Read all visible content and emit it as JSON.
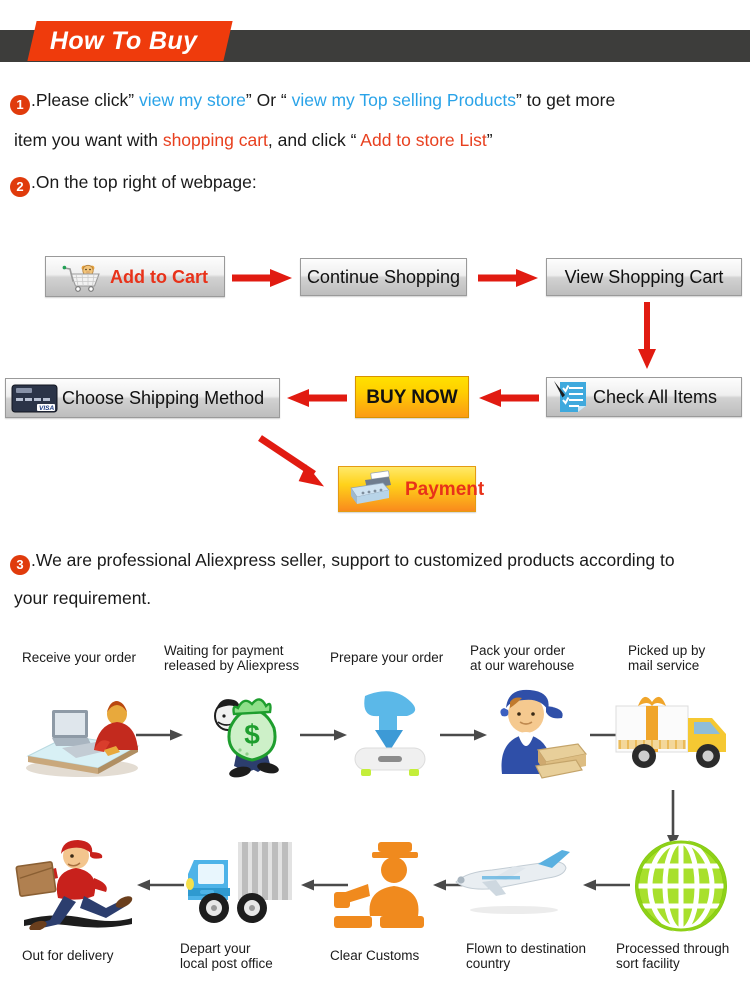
{
  "header": {
    "title": "How To Buy",
    "bar_color": "#3d3d3b",
    "tag_color": "#ef3b0c"
  },
  "steps": [
    {
      "number": "1",
      "lines": [
        [
          {
            "t": ".Please click” ",
            "c": "black"
          },
          {
            "t": "view my store",
            "c": "blue"
          },
          {
            "t": "”  Or  “ ",
            "c": "black"
          },
          {
            "t": "view my Top selling Products",
            "c": "blue"
          },
          {
            "t": "”   to get more",
            "c": "black"
          }
        ],
        [
          {
            "t": "item you want with ",
            "c": "black"
          },
          {
            "t": "shopping cart",
            "c": "red"
          },
          {
            "t": ", and click   “ ",
            "c": "black"
          },
          {
            "t": "Add to store List",
            "c": "red"
          },
          {
            "t": "”",
            "c": "black"
          }
        ]
      ]
    },
    {
      "number": "2",
      "lines": [
        [
          {
            "t": ".On the top right of webpage:",
            "c": "black"
          }
        ]
      ]
    },
    {
      "number": "3",
      "lines": [
        [
          {
            "t": ".We are professional Aliexpress seller, support to customized products according to",
            "c": "black"
          }
        ],
        [
          {
            "t": "your requirement.",
            "c": "black"
          }
        ]
      ]
    }
  ],
  "buy_flow": {
    "buttons": [
      {
        "id": "add-to-cart",
        "label": "Add to Cart",
        "icon": "shopping-cart-icon"
      },
      {
        "id": "continue-shopping",
        "label": "Continue Shopping",
        "icon": ""
      },
      {
        "id": "view-shopping-cart",
        "label": "View Shopping Cart",
        "icon": ""
      },
      {
        "id": "check-all-items",
        "label": "Check All Items",
        "icon": "checklist-icon"
      },
      {
        "id": "buy-now",
        "label": "BUY NOW",
        "icon": ""
      },
      {
        "id": "choose-shipping-method",
        "label": "Choose Shipping Method",
        "icon": "credit-card-icon"
      },
      {
        "id": "payment",
        "label": "Payment",
        "icon": "cash-register-icon"
      }
    ],
    "arrow_color": "#e11b11"
  },
  "shipping_process": {
    "arrow_color": "#4a4a4a",
    "row1": [
      {
        "label": "Receive your order",
        "icon": "person-at-computer-icon"
      },
      {
        "label": "Waiting for payment\nreleased by Aliexpress",
        "icon": "money-bag-icon"
      },
      {
        "label": "Prepare your order",
        "icon": "download-box-icon"
      },
      {
        "label": "Pack your order\nat our warehouse",
        "icon": "worker-with-boxes-icon"
      },
      {
        "label": "Picked up by\nmail service",
        "icon": "delivery-truck-icon"
      }
    ],
    "row2": [
      {
        "label": "Out for delivery",
        "icon": "running-courier-icon"
      },
      {
        "label": "Depart your\nlocal post office",
        "icon": "blue-truck-icon"
      },
      {
        "label": "Clear Customs",
        "icon": "customs-officer-icon"
      },
      {
        "label": "Flown to destination\ncountry",
        "icon": "airplane-icon"
      },
      {
        "label": "Processed through\nsort facility",
        "icon": "green-globe-icon"
      }
    ]
  }
}
